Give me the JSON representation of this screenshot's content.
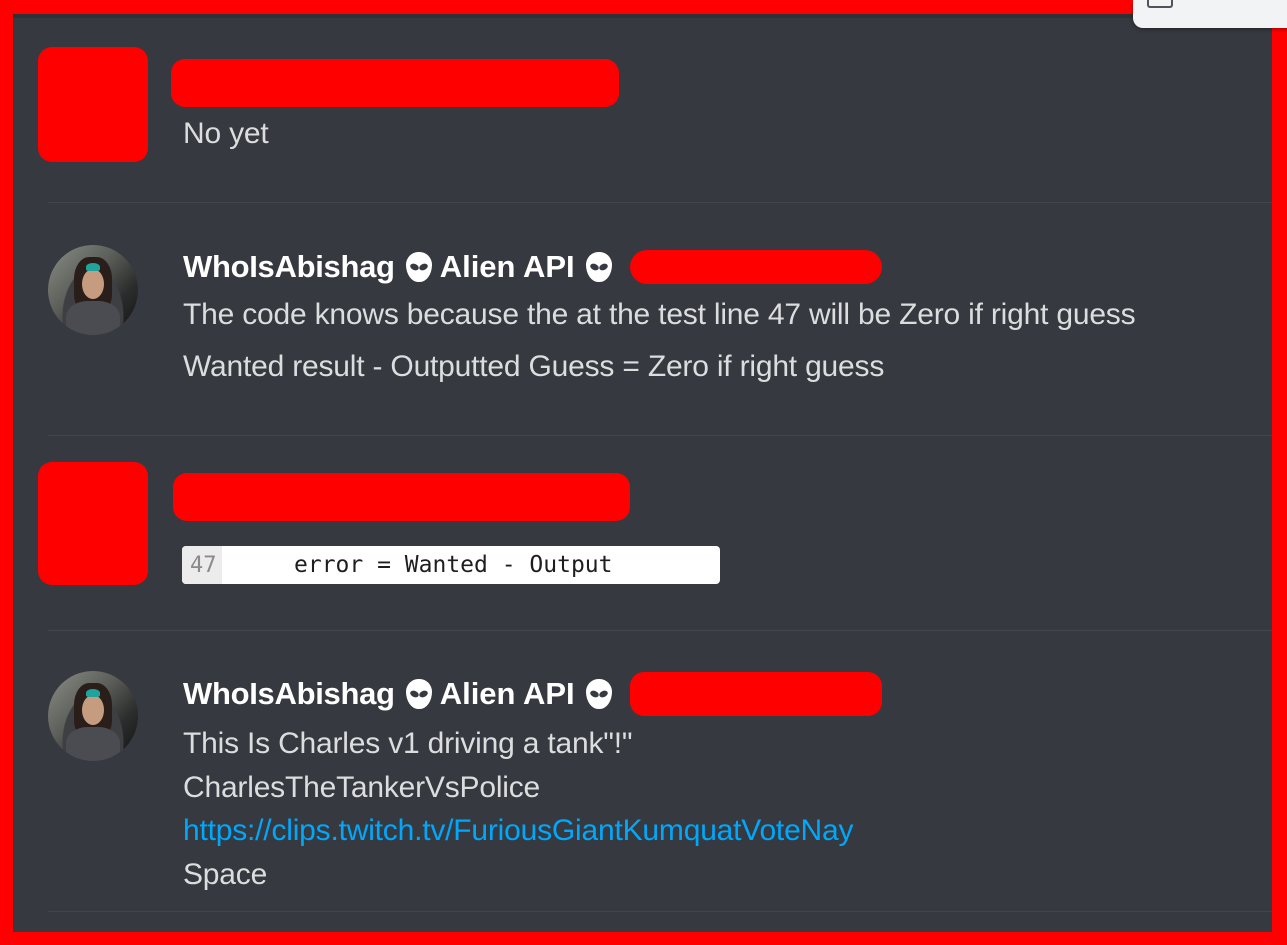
{
  "messages": [
    {
      "author_redacted": true,
      "lines": [
        "No yet"
      ]
    },
    {
      "author": "WhoIsAbishag",
      "role": "Alien API",
      "icons": [
        "alien-icon",
        "alien-icon"
      ],
      "lines": [
        "The code knows because the at the test line 47 will be Zero if right guess",
        "Wanted result - Outputted Guess = Zero if right guess"
      ]
    },
    {
      "author_redacted": true,
      "code": {
        "line_number": "47",
        "content": "error = Wanted - Output"
      }
    },
    {
      "author": "WhoIsAbishag",
      "role": "Alien API",
      "icons": [
        "alien-icon",
        "alien-icon"
      ],
      "lines": [
        "This Is Charles v1 driving a tank\"!\"",
        "CharlesTheTankerVsPolice"
      ],
      "link": "https://clips.twitch.tv/FuriousGiantKumquatVoteNay",
      "after_link": "Space"
    }
  ],
  "colors": {
    "background": "#36393f",
    "redaction": "#ff0000",
    "text": "#dcddde",
    "username": "#ffffff",
    "link": "#00a8fc"
  }
}
